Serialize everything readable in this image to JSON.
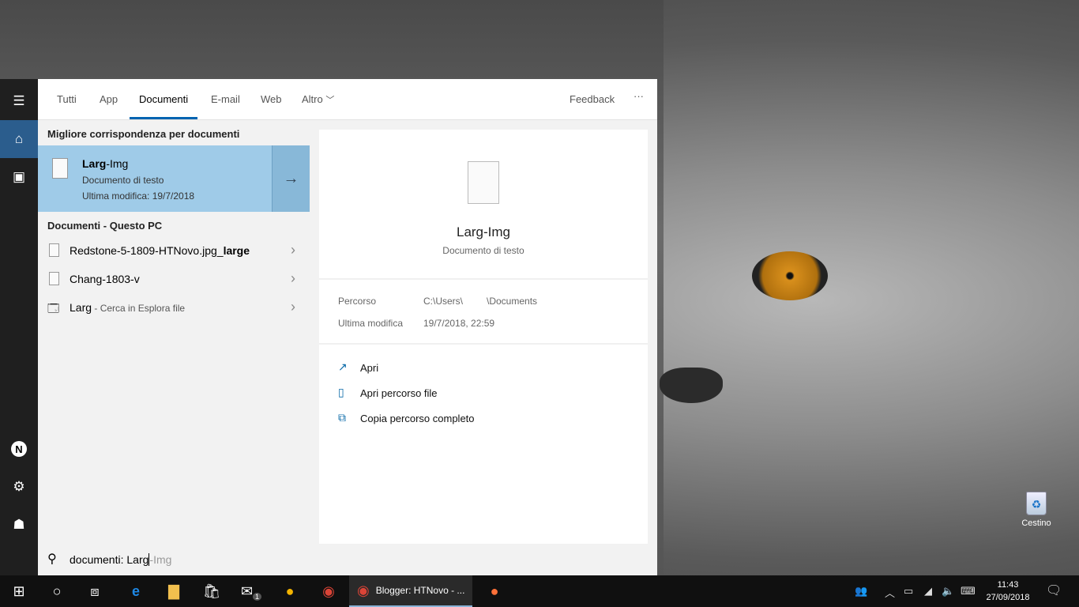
{
  "desktop": {
    "recycle_bin_label": "Cestino"
  },
  "search_panel": {
    "tabs": [
      {
        "label": "Tutti"
      },
      {
        "label": "App"
      },
      {
        "label": "Documenti",
        "active": true
      },
      {
        "label": "E-mail"
      },
      {
        "label": "Web"
      },
      {
        "label": "Altro"
      }
    ],
    "feedback_label": "Feedback",
    "more_label": "···",
    "best_match_header": "Migliore corrispondenza per documenti",
    "best_match": {
      "name_bold": "Larg",
      "name_rest": "-Img",
      "type": "Documento di testo",
      "modified": "Ultima modifica: 19/7/2018"
    },
    "section_header": "Documenti - Questo PC",
    "results": [
      {
        "name": "Redstone-5-1809-HTNovo.jpg_",
        "name_bold": "large",
        "icon": "image-file-icon"
      },
      {
        "name": "Chang-1803-v",
        "name_bold": "",
        "icon": "text-file-icon"
      },
      {
        "name": "Larg",
        "suffix": " - Cerca in Esplora file",
        "icon": "file-explorer-icon"
      }
    ],
    "preview": {
      "title": "Larg-Img",
      "subtitle": "Documento di testo",
      "path_label": "Percorso",
      "path_value_a": "C:\\Users\\",
      "path_value_b": "\\Documents",
      "modified_label": "Ultima modifica",
      "modified_value": "19/7/2018, 22:59",
      "actions": [
        {
          "label": "Apri"
        },
        {
          "label": "Apri percorso file"
        },
        {
          "label": "Copia percorso completo"
        }
      ]
    },
    "query_typed": "documenti: Larg",
    "query_suggest": "-Img"
  },
  "taskbar": {
    "chrome_window_label": "Blogger: HTNovo - ...",
    "mail_badge": "1",
    "time": "11:43",
    "date": "27/09/2018"
  },
  "colors": {
    "accent": "#0063b1",
    "selected": "#9fcbe8"
  }
}
